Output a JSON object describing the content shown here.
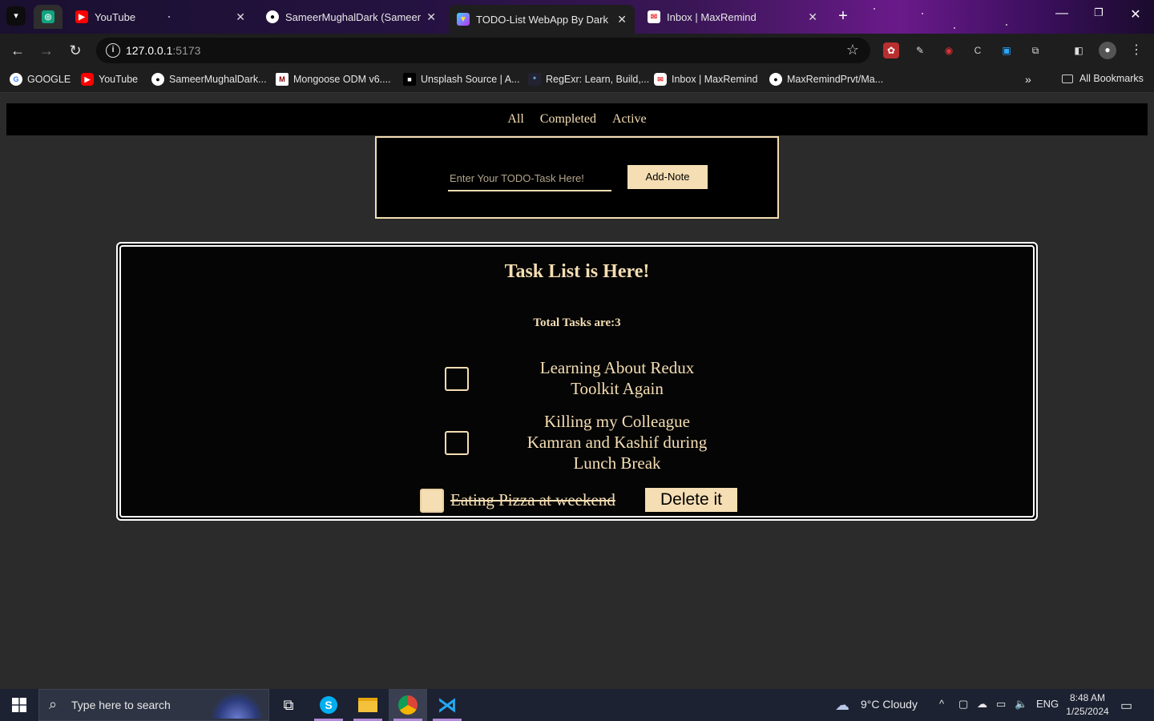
{
  "browser": {
    "tabs": [
      {
        "label": "",
        "icon": "chatgpt-icon"
      },
      {
        "label": "YouTube",
        "icon": "youtube-icon"
      },
      {
        "label": "SameerMughalDark (Sameer Al",
        "icon": "github-icon"
      },
      {
        "label": "TODO-List WebApp By Dark",
        "icon": "vite-icon",
        "active": true
      },
      {
        "label": "Inbox | MaxRemind",
        "icon": "maxremind-icon"
      }
    ],
    "url_host": "127.0.0.1",
    "url_port": ":5173",
    "bookmarks": [
      {
        "label": "GOOGLE",
        "icon": "google-icon"
      },
      {
        "label": "YouTube",
        "icon": "youtube-icon"
      },
      {
        "label": "SameerMughalDark...",
        "icon": "github-icon"
      },
      {
        "label": "Mongoose ODM v6....",
        "icon": "mongoose-icon"
      },
      {
        "label": "Unsplash Source | A...",
        "icon": "unsplash-icon"
      },
      {
        "label": "RegExr: Learn, Build,...",
        "icon": "regexr-icon"
      },
      {
        "label": "Inbox | MaxRemind",
        "icon": "maxremind-icon"
      },
      {
        "label": "MaxRemindPrvt/Ma...",
        "icon": "github-icon"
      }
    ],
    "all_bookmarks": "All Bookmarks"
  },
  "app": {
    "nav": {
      "all": "All",
      "completed": "Completed",
      "active": "Active"
    },
    "input_placeholder": "Enter Your TODO-Task Here!",
    "add_button": "Add-Note",
    "list_title": "Task List is Here!",
    "total_label": "Total Tasks are:3",
    "tasks": [
      {
        "text": "Learning About Redux Toolkit Again",
        "completed": false
      },
      {
        "text": "Killing my Colleague Kamran and Kashif during Lunch Break",
        "completed": false
      },
      {
        "text": "Eating Pizza at weekend",
        "completed": true
      }
    ],
    "delete_button": "Delete it"
  },
  "taskbar": {
    "search_placeholder": "Type here to search",
    "weather": "9°C  Cloudy",
    "language": "ENG",
    "time": "8:48 AM",
    "date": "1/25/2024"
  },
  "colors": {
    "accent": "#f5deb3",
    "background": "#2b2b2b",
    "panel": "#000000"
  }
}
